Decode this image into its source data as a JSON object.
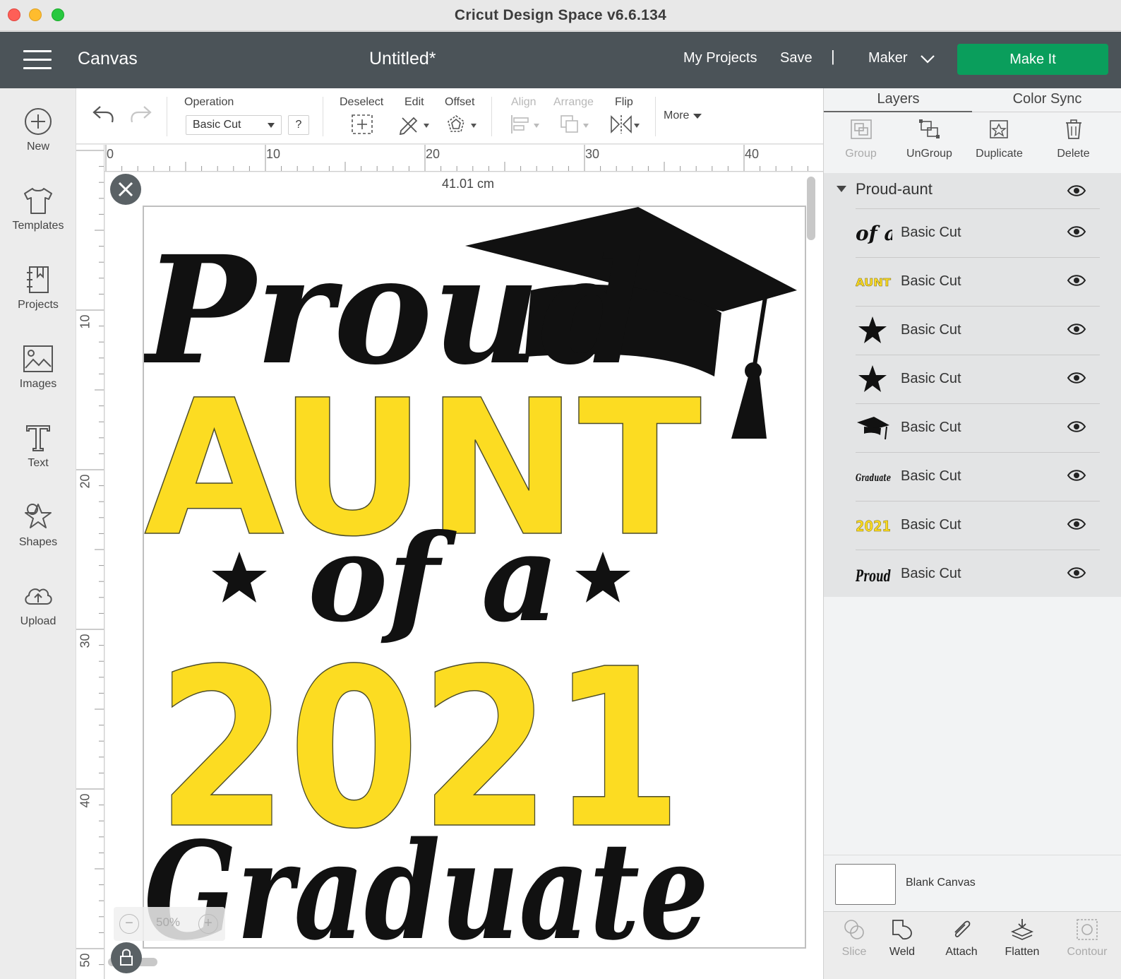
{
  "window": {
    "title": "Cricut Design Space  v6.6.134"
  },
  "header": {
    "menu_icon": "hamburger-icon",
    "section": "Canvas",
    "document_title": "Untitled*",
    "my_projects": "My Projects",
    "save": "Save",
    "separator": "|",
    "machine": "Maker",
    "make_it": "Make It",
    "accent_color": "#0a9e5c"
  },
  "left_toolbar": {
    "items": [
      {
        "label": "New",
        "icon": "plus-circle-icon"
      },
      {
        "label": "Templates",
        "icon": "tshirt-icon"
      },
      {
        "label": "Projects",
        "icon": "projects-icon"
      },
      {
        "label": "Images",
        "icon": "image-icon"
      },
      {
        "label": "Text",
        "icon": "text-icon"
      },
      {
        "label": "Shapes",
        "icon": "shapes-icon"
      },
      {
        "label": "Upload",
        "icon": "cloud-upload-icon"
      }
    ]
  },
  "edit_toolbar": {
    "operation_label": "Operation",
    "operation_value": "Basic Cut",
    "help": "?",
    "deselect": "Deselect",
    "edit": "Edit",
    "offset": "Offset",
    "align": "Align",
    "arrange": "Arrange",
    "flip": "Flip",
    "more": "More"
  },
  "rulers": {
    "horizontal": [
      "0",
      "10",
      "20",
      "30",
      "40"
    ],
    "vertical": [
      "10",
      "20",
      "30",
      "40",
      "50"
    ]
  },
  "canvas": {
    "dimension": "41.01 cm",
    "zoom": "50%",
    "design": {
      "line1": "Proud",
      "line2": "AUNT",
      "line3": "of a",
      "line4": "2021",
      "line5": "Graduate",
      "black_color": "#111111",
      "yellow_color": "#fcdc22"
    }
  },
  "right_panel": {
    "tabs": [
      "Layers",
      "Color Sync"
    ],
    "tools": [
      {
        "label": "Group",
        "icon": "group-icon",
        "enabled": false
      },
      {
        "label": "UnGroup",
        "icon": "ungroup-icon",
        "enabled": true
      },
      {
        "label": "Duplicate",
        "icon": "duplicate-icon",
        "enabled": true
      },
      {
        "label": "Delete",
        "icon": "trash-icon",
        "enabled": true
      }
    ],
    "group_name": "Proud-aunt",
    "layers": [
      {
        "thumb": "of a",
        "name": "Basic Cut",
        "kind": "script"
      },
      {
        "thumb": "AUNT",
        "name": "Basic Cut",
        "kind": "yellow"
      },
      {
        "thumb": "star",
        "name": "Basic Cut",
        "kind": "star"
      },
      {
        "thumb": "star",
        "name": "Basic Cut",
        "kind": "star"
      },
      {
        "thumb": "cap",
        "name": "Basic Cut",
        "kind": "cap"
      },
      {
        "thumb": "Graduate",
        "name": "Basic Cut",
        "kind": "script-small"
      },
      {
        "thumb": "2021",
        "name": "Basic Cut",
        "kind": "yellow"
      },
      {
        "thumb": "Proud",
        "name": "Basic Cut",
        "kind": "script"
      }
    ],
    "blank_canvas": "Blank Canvas",
    "bottom_tools": [
      {
        "label": "Slice",
        "icon": "slice-icon",
        "enabled": false
      },
      {
        "label": "Weld",
        "icon": "weld-icon",
        "enabled": true
      },
      {
        "label": "Attach",
        "icon": "paperclip-icon",
        "enabled": true
      },
      {
        "label": "Flatten",
        "icon": "flatten-icon",
        "enabled": true
      },
      {
        "label": "Contour",
        "icon": "contour-icon",
        "enabled": false
      }
    ]
  }
}
